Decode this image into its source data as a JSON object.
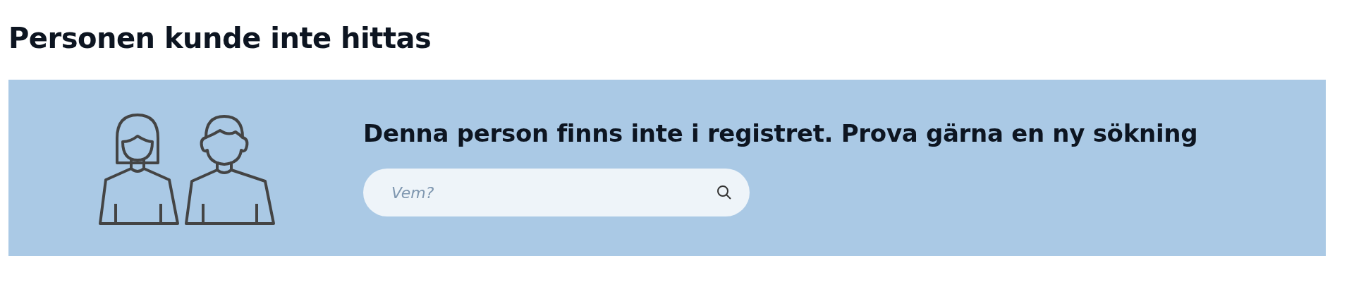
{
  "heading": "Personen kunde inte hittas",
  "panel": {
    "message": "Denna person finns inte i registret. Prova gärna en ny sökning",
    "search": {
      "placeholder": "Vem?"
    }
  }
}
